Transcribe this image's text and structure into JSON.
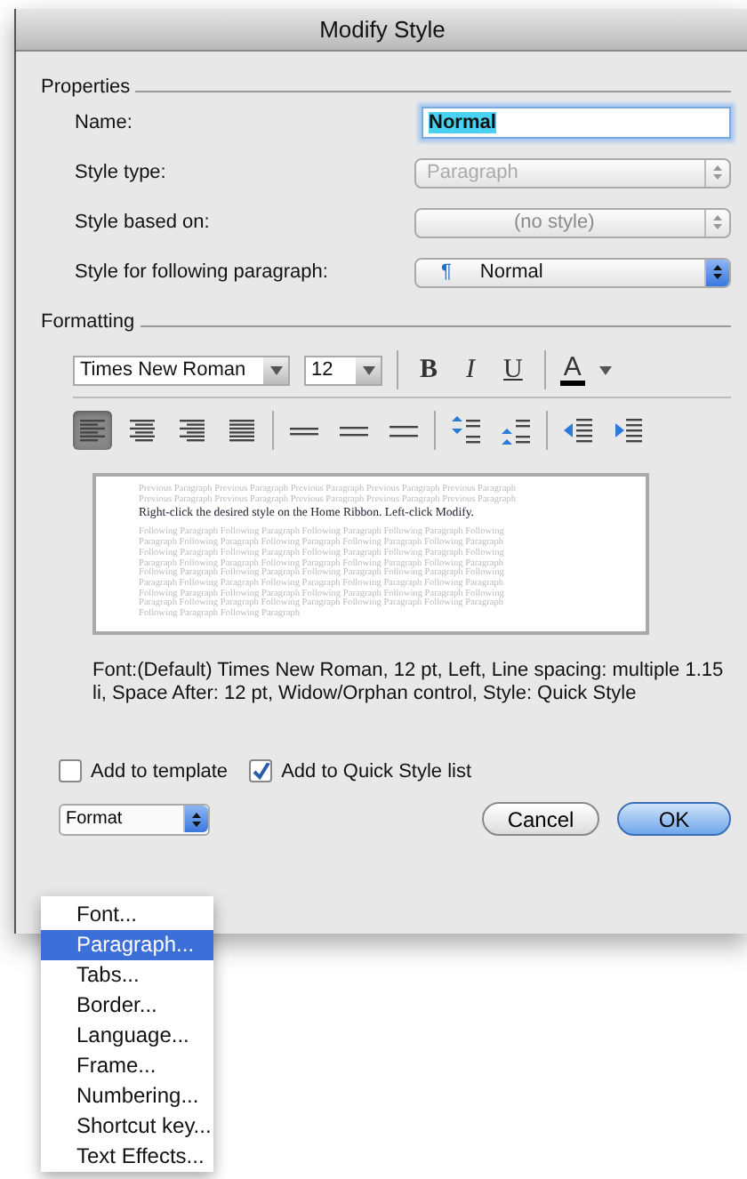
{
  "window": {
    "title": "Modify Style"
  },
  "properties": {
    "heading": "Properties",
    "name": {
      "label": "Name:",
      "value": "Normal"
    },
    "style_type": {
      "label": "Style type:",
      "value": "Paragraph",
      "disabled": true
    },
    "style_based_on": {
      "label": "Style based on:",
      "value": "(no style)",
      "disabled": true
    },
    "style_following": {
      "label": "Style for following paragraph:",
      "value": "Normal",
      "mark": "¶",
      "disabled": false
    }
  },
  "formatting": {
    "heading": "Formatting",
    "font": "Times New Roman",
    "size": "12",
    "bold": "B",
    "italic": "I",
    "underline": "U",
    "font_color": "A",
    "alignment": [
      {
        "kind": "left",
        "selected": true
      },
      {
        "kind": "center",
        "selected": false
      },
      {
        "kind": "right",
        "selected": false
      },
      {
        "kind": "justify",
        "selected": false
      }
    ],
    "spacing": [
      {
        "kind": "single"
      },
      {
        "kind": "onehalf"
      },
      {
        "kind": "double"
      }
    ],
    "paragraph_spacing": [
      {
        "kind": "before"
      },
      {
        "kind": "after"
      }
    ],
    "indent": [
      {
        "kind": "decrease"
      },
      {
        "kind": "increase"
      }
    ]
  },
  "preview": {
    "previous": "Previous Paragraph Previous Paragraph Previous Paragraph Previous Paragraph Previous Paragraph Previous Paragraph Previous Paragraph Previous Paragraph Previous Paragraph Previous Paragraph",
    "sample": "Right-click the desired style on the Home Ribbon. Left-click Modify.",
    "following": "Following Paragraph Following Paragraph Following Paragraph Following Paragraph Following Paragraph Following Paragraph Following Paragraph Following Paragraph Following Paragraph Following Paragraph Following Paragraph Following Paragraph Following Paragraph Following Paragraph Following Paragraph Following Paragraph Following Paragraph Following Paragraph Following Paragraph Following Paragraph Following Paragraph Following Paragraph Following Paragraph Following Paragraph Following Paragraph Following Paragraph Following Paragraph Following Paragraph Following Paragraph Following Paragraph Following Paragraph Following Paragraph Following Paragraph Following Paragraph Following Paragraph Following Paragraph Following Paragraph Following Paragraph"
  },
  "description": "Font:(Default) Times New Roman, 12 pt, Left, Line spacing:  multiple 1.15 li, Space After:  12 pt, Widow/Orphan control, Style: Quick Style",
  "options": [
    {
      "label": "Add to template",
      "checked": false
    },
    {
      "label": "Add to Quick Style list",
      "checked": true
    }
  ],
  "format_button": "Format",
  "buttons": [
    {
      "label": "Cancel",
      "kind": "normal"
    },
    {
      "label": "OK",
      "kind": "default"
    }
  ],
  "format_menu": [
    {
      "label": "Font...",
      "selected": false
    },
    {
      "label": "Paragraph...",
      "selected": true
    },
    {
      "label": "Tabs...",
      "selected": false
    },
    {
      "label": "Border...",
      "selected": false
    },
    {
      "label": "Language...",
      "selected": false
    },
    {
      "label": "Frame...",
      "selected": false
    },
    {
      "label": "Numbering...",
      "selected": false
    },
    {
      "label": "Shortcut key...",
      "selected": false
    },
    {
      "label": "Text Effects...",
      "selected": false
    }
  ]
}
